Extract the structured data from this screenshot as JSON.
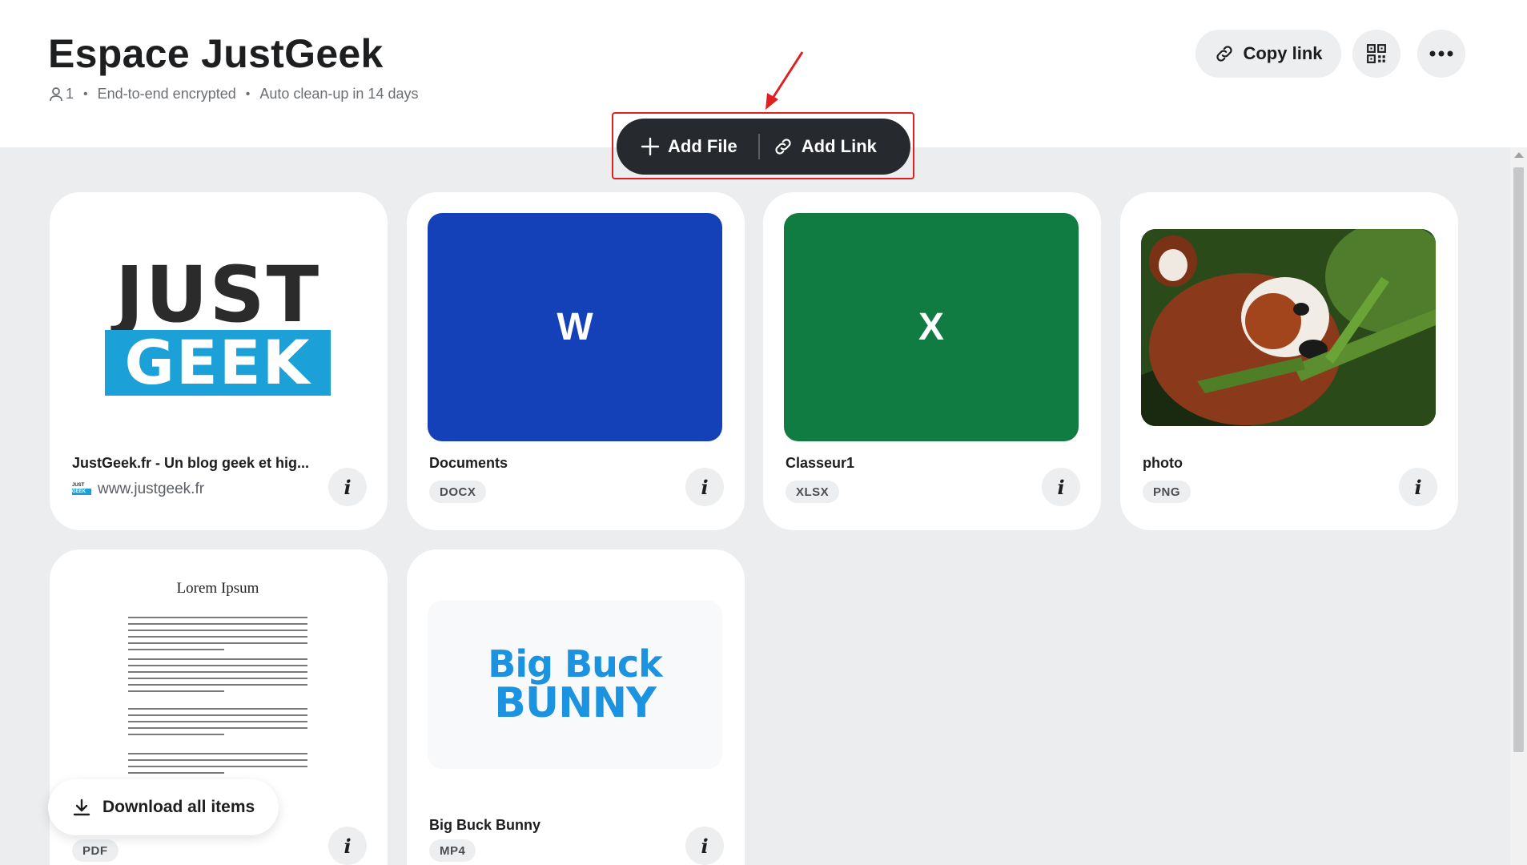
{
  "header": {
    "title": "Espace JustGeek",
    "members_count": "1",
    "encryption": "End-to-end encrypted",
    "cleanup": "Auto clean-up in 14 days",
    "copy_link_label": "Copy link"
  },
  "actions": {
    "add_file_label": "Add File",
    "add_link_label": "Add Link"
  },
  "items": [
    {
      "name": "JustGeek.fr - Un blog geek et hig...",
      "url": "www.justgeek.fr",
      "logo_top": "JUST",
      "logo_bottom": "GEEK",
      "favicon_top": "JUST",
      "favicon_bottom": "GEEK"
    },
    {
      "name": "Documents",
      "type": "DOCX",
      "letter": "W",
      "color": "#1541b8"
    },
    {
      "name": "Classeur1",
      "type": "XLSX",
      "letter": "X",
      "color": "#107c41"
    },
    {
      "name": "photo",
      "type": "PNG"
    },
    {
      "type": "PDF",
      "doc_title": "Lorem Ipsum"
    },
    {
      "name": "Big Buck Bunny",
      "type": "MP4",
      "logo_line1": "Big Buck",
      "logo_line2": "BUNNY"
    }
  ],
  "download_all_label": "Download all items",
  "colors": {
    "accent_dark": "#26292d",
    "highlight": "#e02020",
    "justgeek_blue": "#1ba1d8",
    "bunny_blue": "#1c93e0"
  }
}
